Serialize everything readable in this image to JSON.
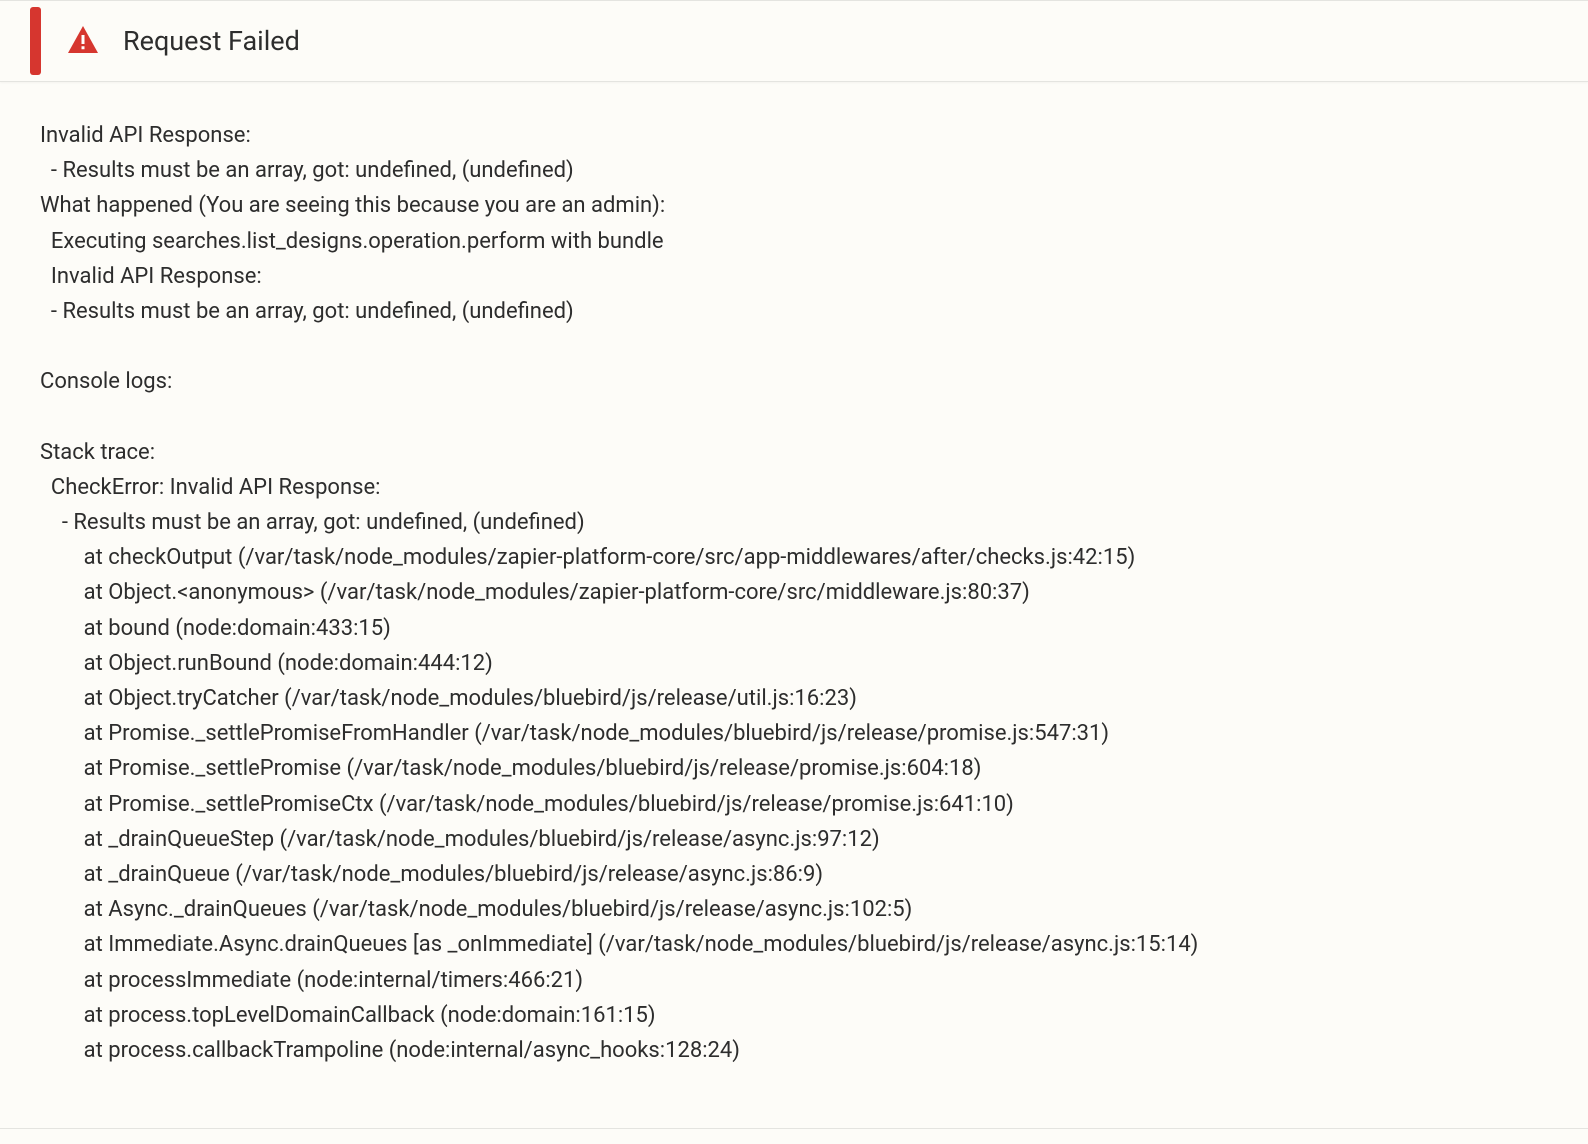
{
  "header": {
    "title": "Request Failed"
  },
  "body": {
    "text": "Invalid API Response:\n  - Results must be an array, got: undefined, (undefined)\nWhat happened (You are seeing this because you are an admin):\n  Executing searches.list_designs.operation.perform with bundle\n  Invalid API Response:\n  - Results must be an array, got: undefined, (undefined)\n\nConsole logs:\n\nStack trace:\n  CheckError: Invalid API Response:\n    - Results must be an array, got: undefined, (undefined)\n        at checkOutput (/var/task/node_modules/zapier-platform-core/src/app-middlewares/after/checks.js:42:15)\n        at Object.<anonymous> (/var/task/node_modules/zapier-platform-core/src/middleware.js:80:37)\n        at bound (node:domain:433:15)\n        at Object.runBound (node:domain:444:12)\n        at Object.tryCatcher (/var/task/node_modules/bluebird/js/release/util.js:16:23)\n        at Promise._settlePromiseFromHandler (/var/task/node_modules/bluebird/js/release/promise.js:547:31)\n        at Promise._settlePromise (/var/task/node_modules/bluebird/js/release/promise.js:604:18)\n        at Promise._settlePromiseCtx (/var/task/node_modules/bluebird/js/release/promise.js:641:10)\n        at _drainQueueStep (/var/task/node_modules/bluebird/js/release/async.js:97:12)\n        at _drainQueue (/var/task/node_modules/bluebird/js/release/async.js:86:9)\n        at Async._drainQueues (/var/task/node_modules/bluebird/js/release/async.js:102:5)\n        at Immediate.Async.drainQueues [as _onImmediate] (/var/task/node_modules/bluebird/js/release/async.js:15:14)\n        at processImmediate (node:internal/timers:466:21)\n        at process.topLevelDomainCallback (node:domain:161:15)\n        at process.callbackTrampoline (node:internal/async_hooks:128:24)"
  }
}
